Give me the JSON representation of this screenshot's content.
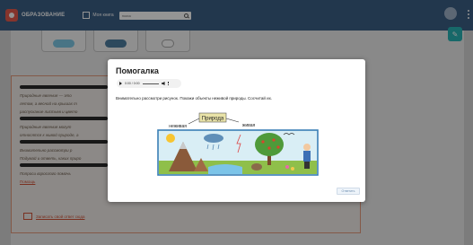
{
  "header": {
    "logo_small": "",
    "logo_big": "ОБРАЗОВАНИЕ",
    "catalog_label": "Моя книга",
    "search_placeholder": "поиск",
    "user_name": "",
    "user_role": ""
  },
  "background": {
    "card_label": "",
    "fab_icon": "edit-icon",
    "text_lines": [
      "Природные явления — это",
      "летом, а весной на крышах т",
      "распускание листьев и цвето",
      "",
      "Природные явления могут",
      "относятся к живой природе, а",
      "",
      "Внимательно рассмотри р",
      "Подумай и ответь, каких приро",
      "",
      "Попроси взрослого помочь"
    ],
    "link_text": "Помощь",
    "footer_link": "Записать свой ответ сюда"
  },
  "modal": {
    "title": "Помогалка",
    "player_time": "0:00 / 0:00",
    "instruction": "Внимательно рассмотри рисунок. Покажи объекты неживой природы. Сосчитай их.",
    "diagram": {
      "center_label": "Природа",
      "left_label": "неживая",
      "right_label": "живая"
    },
    "submit_label": "Ответить"
  },
  "colors": {
    "topbar": "#3c5f86",
    "accent_orange": "#d2553a",
    "fab": "#28b4b6"
  }
}
